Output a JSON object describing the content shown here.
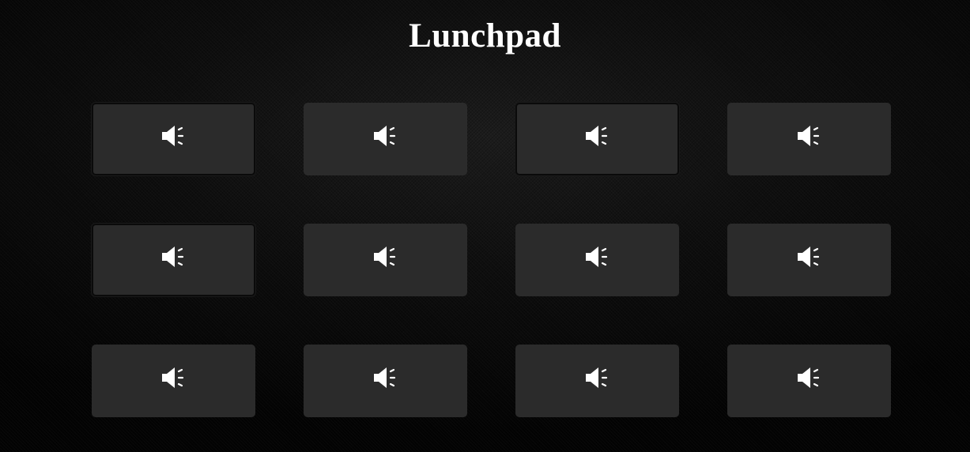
{
  "app": {
    "title": "Lunchpad"
  },
  "pads": [
    {
      "icon": "speaker-icon",
      "framed": true
    },
    {
      "icon": "speaker-icon",
      "framed": false
    },
    {
      "icon": "speaker-icon",
      "framed": true
    },
    {
      "icon": "speaker-icon",
      "framed": false
    },
    {
      "icon": "speaker-icon",
      "framed": true
    },
    {
      "icon": "speaker-icon",
      "framed": false
    },
    {
      "icon": "speaker-icon",
      "framed": false
    },
    {
      "icon": "speaker-icon",
      "framed": false
    },
    {
      "icon": "speaker-icon",
      "framed": false
    },
    {
      "icon": "speaker-icon",
      "framed": false
    },
    {
      "icon": "speaker-icon",
      "framed": false
    },
    {
      "icon": "speaker-icon",
      "framed": false
    }
  ],
  "colors": {
    "pad_background": "#2b2b2b",
    "icon": "#ffffff",
    "title": "#ffffff"
  }
}
